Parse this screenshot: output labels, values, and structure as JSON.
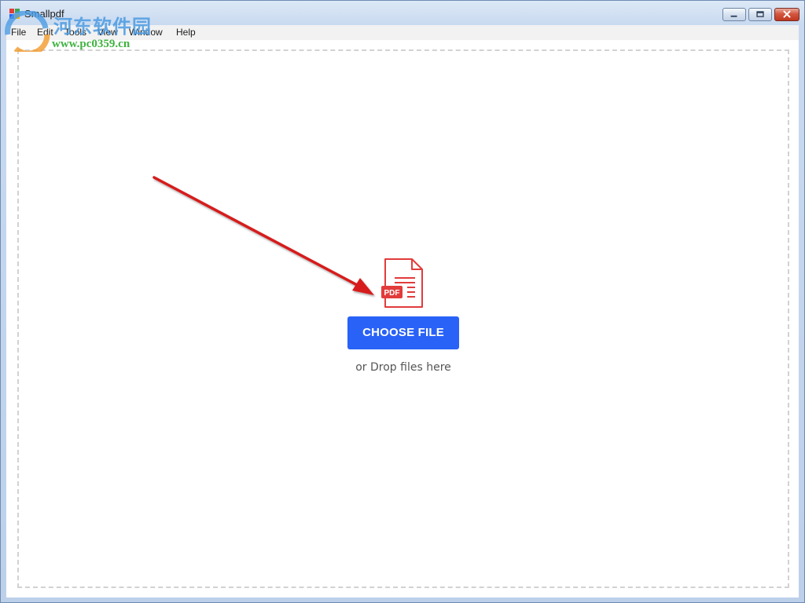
{
  "window": {
    "title": "Smallpdf"
  },
  "menu": {
    "items": [
      "File",
      "Edit",
      "Tools",
      "View",
      "Window",
      "Help"
    ]
  },
  "upload": {
    "icon_badge": "PDF",
    "choose_label": "CHOOSE FILE",
    "drop_hint": "or Drop files here"
  },
  "watermark": {
    "site_name": "河东软件园",
    "url": "www.pc0359.cn"
  },
  "icons": {
    "app": "smallpdf-app-icon",
    "file": "pdf-file-icon",
    "annotation": "red-arrow-icon"
  },
  "colors": {
    "accent": "#2962f7",
    "pdf_red": "#e23b3b",
    "arrow_red": "#d61f1f",
    "dropzone_border": "#d2d2d2",
    "hint_text": "#555555"
  }
}
